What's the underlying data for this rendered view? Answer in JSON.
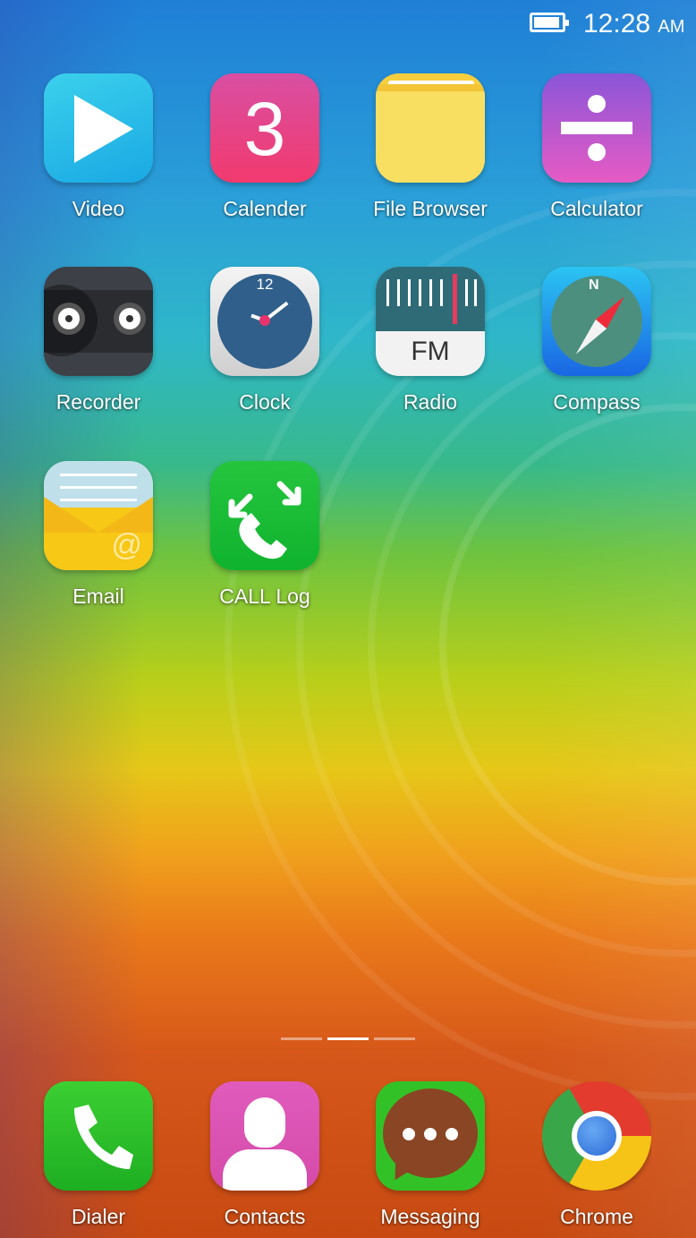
{
  "status_bar": {
    "time": "12:28",
    "ampm": "AM",
    "battery_icon": "battery-icon"
  },
  "apps": [
    {
      "label": "Video",
      "icon": "video-icon"
    },
    {
      "label": "Calender",
      "icon": "calendar-icon",
      "icon_text": "3"
    },
    {
      "label": "File Browser",
      "icon": "folder-icon"
    },
    {
      "label": "Calculator",
      "icon": "calculator-icon"
    },
    {
      "label": "Recorder",
      "icon": "recorder-icon"
    },
    {
      "label": "Clock",
      "icon": "clock-icon",
      "icon_text": "12"
    },
    {
      "label": "Radio",
      "icon": "radio-icon",
      "icon_text": "FM"
    },
    {
      "label": "Compass",
      "icon": "compass-icon",
      "icon_text": "N"
    },
    {
      "label": "Email",
      "icon": "email-icon",
      "icon_text": "@"
    },
    {
      "label": "CALL Log",
      "icon": "call-log-icon"
    }
  ],
  "page_indicator": {
    "pages": 3,
    "active": 2
  },
  "dock": [
    {
      "label": "Dialer",
      "icon": "phone-icon"
    },
    {
      "label": "Contacts",
      "icon": "contacts-icon"
    },
    {
      "label": "Messaging",
      "icon": "messaging-icon"
    },
    {
      "label": "Chrome",
      "icon": "chrome-icon"
    }
  ]
}
